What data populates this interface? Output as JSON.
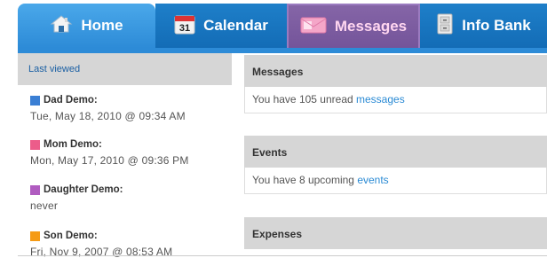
{
  "tabs": {
    "home": {
      "label": "Home",
      "icon": "house-icon"
    },
    "calendar": {
      "label": "Calendar",
      "icon": "calendar-icon",
      "icon_text": "31"
    },
    "messages": {
      "label": "Messages",
      "icon": "envelope-icon"
    },
    "infobank": {
      "label": "Info Bank",
      "icon": "filing-cabinet-icon"
    }
  },
  "sidebar": {
    "header_link": "Last viewed",
    "entries": [
      {
        "name": "Dad Demo:",
        "color": "#3a7fd4",
        "date": "Tue, May 18, 2010 @ 09:34 AM"
      },
      {
        "name": "Mom Demo:",
        "color": "#ec5c8a",
        "date": "Mon, May 17, 2010 @ 09:36 PM"
      },
      {
        "name": "Daughter Demo:",
        "color": "#b05cc0",
        "date": "never"
      },
      {
        "name": "Son Demo:",
        "color": "#f59b16",
        "date": "Fri, Nov 9, 2007 @ 08:53 AM"
      }
    ]
  },
  "panels": {
    "messages": {
      "title": "Messages",
      "text": "You have 105 unread",
      "link": "messages"
    },
    "events": {
      "title": "Events",
      "text": "You have 8 upcoming",
      "link": "events"
    },
    "expenses": {
      "title": "Expenses"
    }
  },
  "colors": {
    "tab_blue": "#2d8bd7",
    "tab_dark_blue": "#136cb6",
    "tab_selected_purple": "#74549a",
    "link_blue": "#2a8ad4"
  }
}
